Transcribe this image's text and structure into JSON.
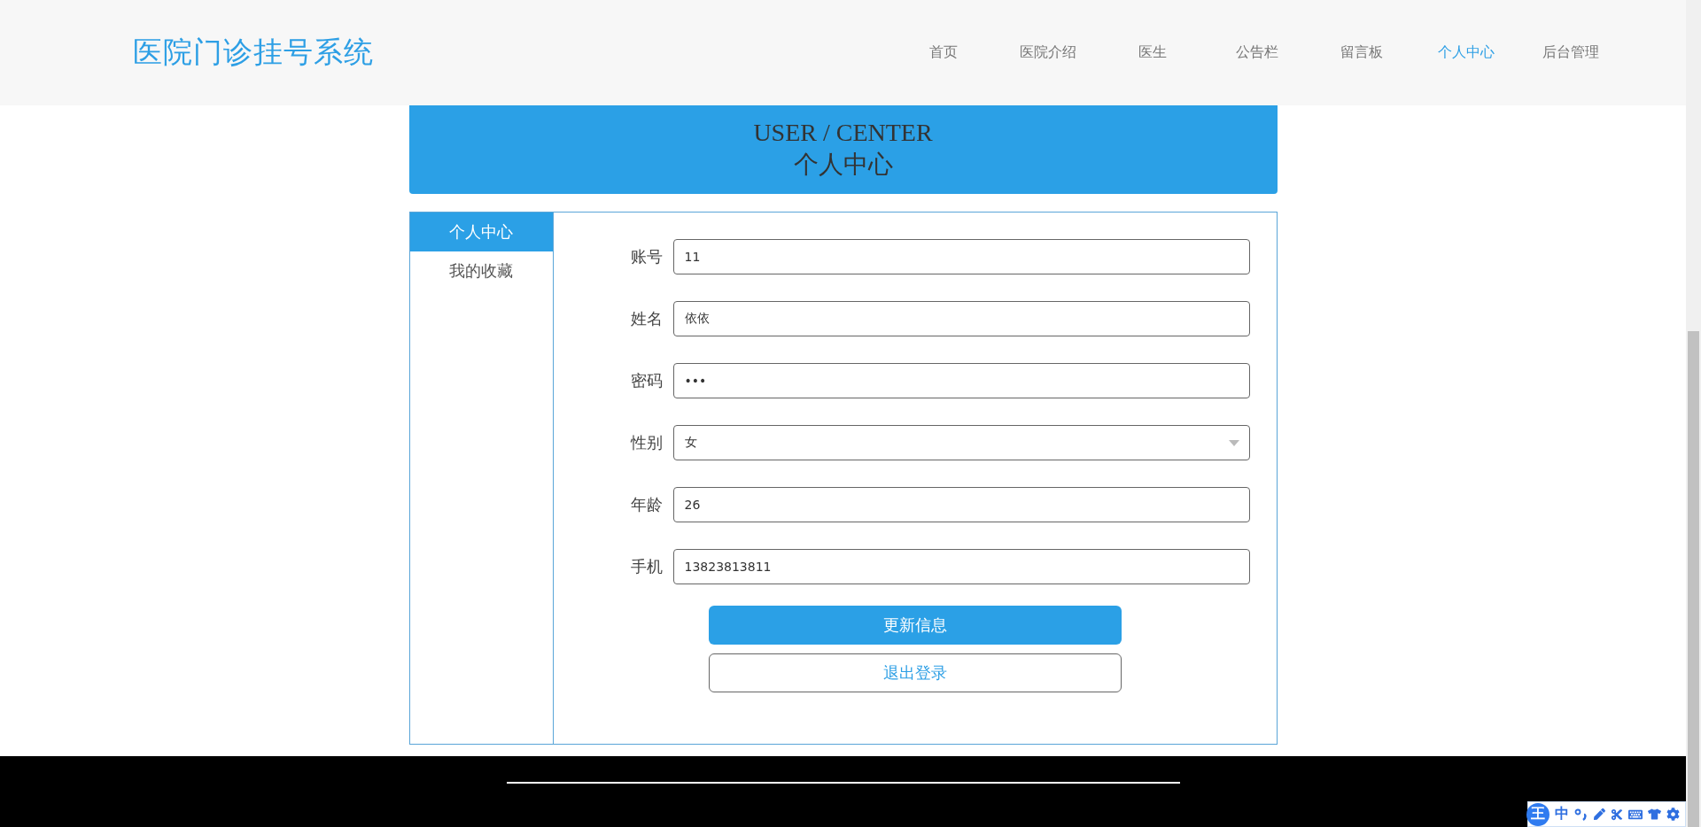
{
  "header": {
    "logo": "医院门诊挂号系统",
    "nav": [
      {
        "label": "首页",
        "selected": false
      },
      {
        "label": "医院介绍",
        "selected": false
      },
      {
        "label": "医生",
        "selected": false
      },
      {
        "label": "公告栏",
        "selected": false
      },
      {
        "label": "留言板",
        "selected": false
      },
      {
        "label": "个人中心",
        "selected": true
      },
      {
        "label": "后台管理",
        "selected": false
      }
    ]
  },
  "banner": {
    "title_en": "USER / CENTER",
    "title_zh": "个人中心"
  },
  "sidebar": {
    "items": [
      {
        "label": "个人中心",
        "selected": true
      },
      {
        "label": "我的收藏",
        "selected": false
      }
    ]
  },
  "form": {
    "fields": [
      {
        "kind": "text",
        "label": "账号",
        "value": "11"
      },
      {
        "kind": "text",
        "label": "姓名",
        "value": "依依"
      },
      {
        "kind": "password",
        "label": "密码",
        "value": "•••"
      },
      {
        "kind": "select",
        "label": "性别",
        "value": "女"
      },
      {
        "kind": "text",
        "label": "年龄",
        "value": "26"
      },
      {
        "kind": "text",
        "label": "手机",
        "value": "13823813811"
      }
    ],
    "buttons": [
      {
        "kind": "primary",
        "label": "更新信息"
      },
      {
        "kind": "outline",
        "label": "退出登录"
      }
    ]
  },
  "ime_toolbar": {
    "logo": "王",
    "mode": "中"
  }
}
